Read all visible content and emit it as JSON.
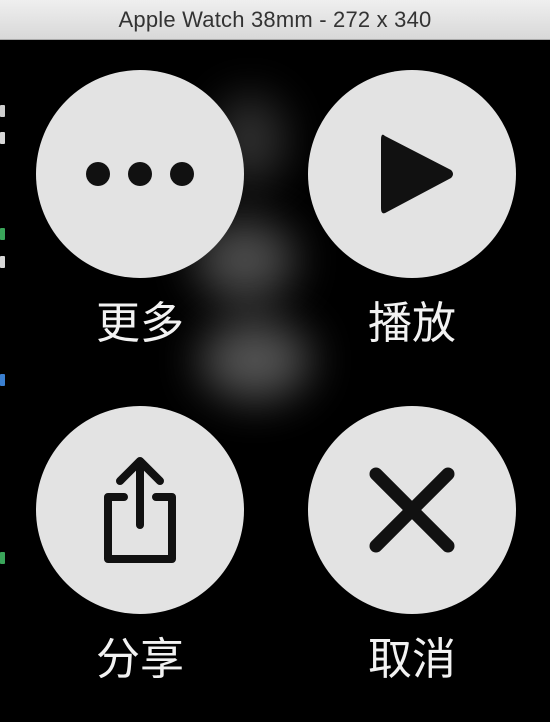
{
  "window": {
    "title": "Apple Watch 38mm - 272 x 340"
  },
  "actions": [
    {
      "id": "more",
      "label": "更多",
      "icon": "ellipsis-icon"
    },
    {
      "id": "play",
      "label": "播放",
      "icon": "play-icon"
    },
    {
      "id": "share",
      "label": "分享",
      "icon": "share-icon"
    },
    {
      "id": "cancel",
      "label": "取消",
      "icon": "close-icon"
    }
  ],
  "colors": {
    "background": "#000000",
    "button_fill": "#e3e3e3",
    "icon": "#111111",
    "label": "#f2f2f2"
  }
}
